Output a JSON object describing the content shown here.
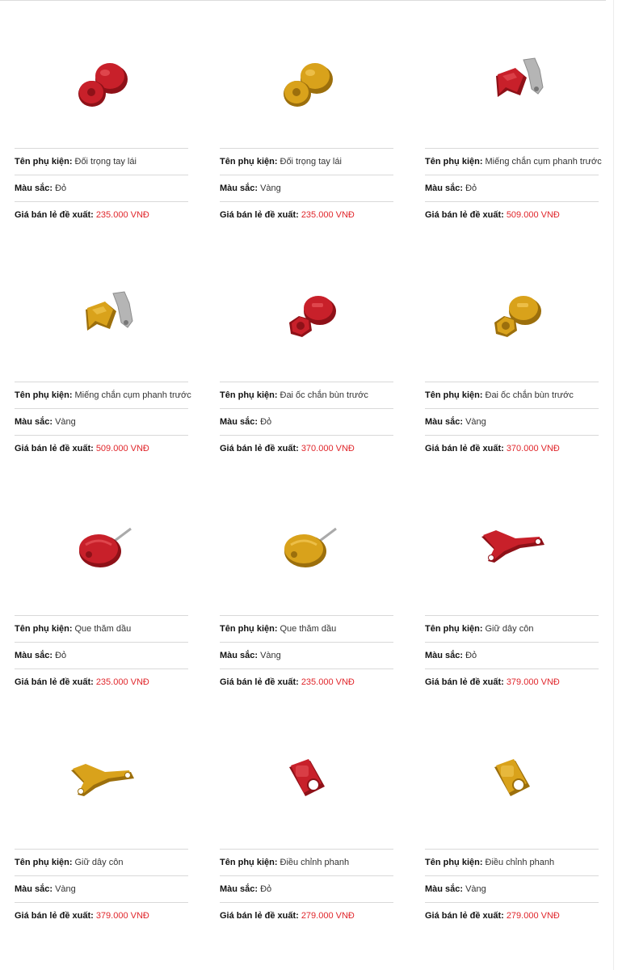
{
  "labels": {
    "name": "Tên phụ kiện:",
    "color": "Màu sắc:",
    "price": "Giá bán lẻ đề xuất:"
  },
  "colors": {
    "red": "#c8202a",
    "gold": "#d9a21b",
    "price": "#e0262b",
    "divider": "#d9d9d9"
  },
  "products": [
    {
      "name": "Đối trọng tay lái",
      "color": "Đỏ",
      "price": "235.000 VNĐ",
      "icon": "bar-end-weight-icon",
      "tone": "red"
    },
    {
      "name": "Đối trọng tay lái",
      "color": "Vàng",
      "price": "235.000 VNĐ",
      "icon": "bar-end-weight-icon",
      "tone": "gold"
    },
    {
      "name": "Miếng chắn cụm phanh trước",
      "color": "Đỏ",
      "price": "509.000 VNĐ",
      "icon": "brake-guard-icon",
      "tone": "red"
    },
    {
      "name": "Miếng chắn cụm phanh trước",
      "color": "Vàng",
      "price": "509.000 VNĐ",
      "icon": "brake-guard-icon",
      "tone": "gold"
    },
    {
      "name": "Đai ốc chắn bùn trước",
      "color": "Đỏ",
      "price": "370.000 VNĐ",
      "icon": "fender-nut-icon",
      "tone": "red"
    },
    {
      "name": "Đai ốc chắn bùn trước",
      "color": "Vàng",
      "price": "370.000 VNĐ",
      "icon": "fender-nut-icon",
      "tone": "gold"
    },
    {
      "name": "Que thăm dầu",
      "color": "Đỏ",
      "price": "235.000 VNĐ",
      "icon": "oil-dipstick-icon",
      "tone": "red"
    },
    {
      "name": "Que thăm dầu",
      "color": "Vàng",
      "price": "235.000 VNĐ",
      "icon": "oil-dipstick-icon",
      "tone": "gold"
    },
    {
      "name": "Giữ dây côn",
      "color": "Đỏ",
      "price": "379.000 VNĐ",
      "icon": "clutch-cable-holder-icon",
      "tone": "red"
    },
    {
      "name": "Giữ dây côn",
      "color": "Vàng",
      "price": "379.000 VNĐ",
      "icon": "clutch-cable-holder-icon",
      "tone": "gold"
    },
    {
      "name": "Điều chỉnh phanh",
      "color": "Đỏ",
      "price": "279.000 VNĐ",
      "icon": "brake-adjuster-icon",
      "tone": "red"
    },
    {
      "name": "Điều chỉnh phanh",
      "color": "Vàng",
      "price": "279.000 VNĐ",
      "icon": "brake-adjuster-icon",
      "tone": "gold"
    }
  ]
}
